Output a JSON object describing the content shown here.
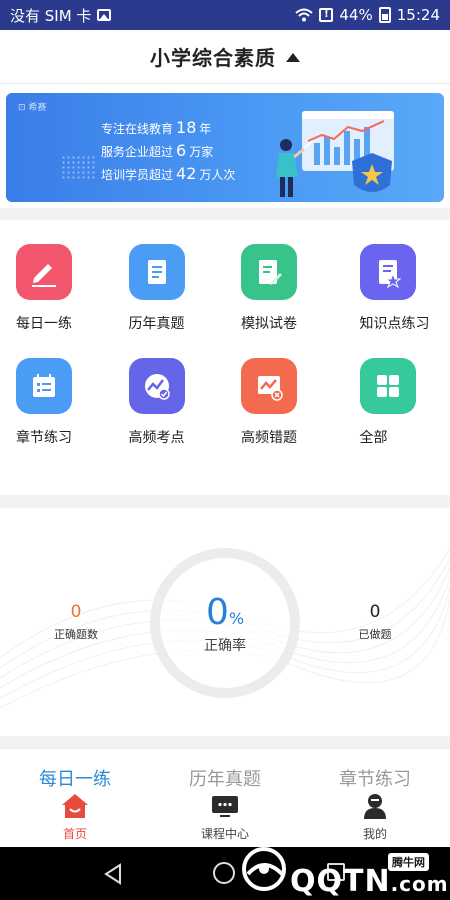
{
  "status_bar": {
    "carrier": "没有 SIM 卡",
    "battery": "44%",
    "time": "15:24"
  },
  "header": {
    "title": "小学综合素质"
  },
  "banner": {
    "logo": "⊡ 希赛",
    "line1_prefix": "专注在线教育",
    "line1_num": "18",
    "line1_suffix": "年",
    "line2_prefix": "服务企业超过",
    "line2_num": "6",
    "line2_suffix": "万家",
    "line3_prefix": "培训学员超过",
    "line3_num": "42",
    "line3_suffix": "万人次"
  },
  "grid": [
    {
      "label": "每日一练",
      "icon": "pencil-icon",
      "color": "#f2566c"
    },
    {
      "label": "历年真题",
      "icon": "document-icon",
      "color": "#4a9cf4"
    },
    {
      "label": "模拟试卷",
      "icon": "edit-paper-icon",
      "color": "#38c38a"
    },
    {
      "label": "知识点练习",
      "icon": "star-doc-icon",
      "color": "#6a64f0"
    },
    {
      "label": "章节练习",
      "icon": "calendar-list-icon",
      "color": "#4a9cf4"
    },
    {
      "label": "高频考点",
      "icon": "chart-check-icon",
      "color": "#6565e8"
    },
    {
      "label": "高频错题",
      "icon": "chart-error-icon",
      "color": "#f46a4e"
    },
    {
      "label": "全部",
      "icon": "grid-icon",
      "color": "#36c99b"
    }
  ],
  "stats": {
    "correct_count": "0",
    "correct_count_label": "正确题数",
    "accuracy": "0",
    "accuracy_unit": "%",
    "accuracy_label": "正确率",
    "done_count": "0",
    "done_count_label": "已做题"
  },
  "quick_tabs": [
    "每日一练",
    "历年真题",
    "章节练习"
  ],
  "nav": [
    {
      "label": "首页",
      "icon": "home-icon"
    },
    {
      "label": "课程中心",
      "icon": "course-icon"
    },
    {
      "label": "我的",
      "icon": "profile-icon"
    }
  ],
  "watermark": {
    "tag": "腾牛网",
    "text": "QQTN",
    "suffix": ".com"
  },
  "colors": {
    "accent_blue": "#2a8ad7",
    "nav_active": "#e64c3c",
    "status_bar": "#2b3a8c",
    "correct_orange": "#e8762e"
  }
}
